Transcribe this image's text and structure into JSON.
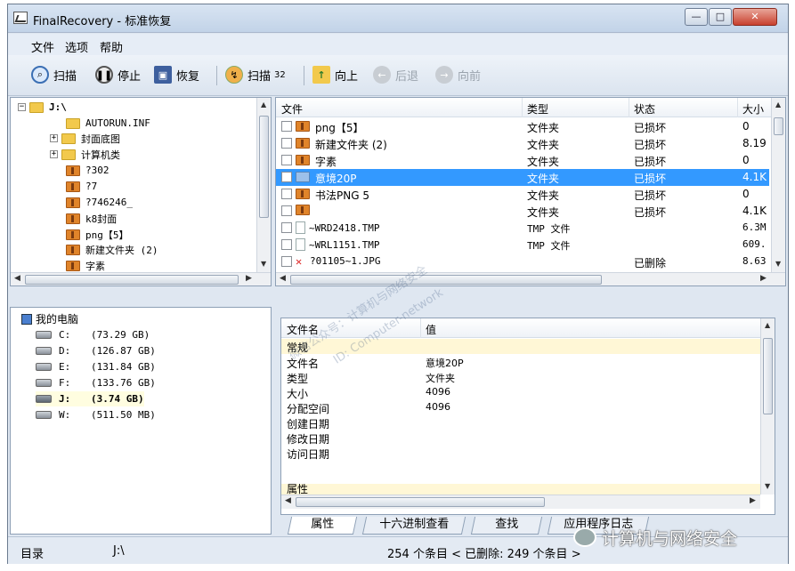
{
  "window": {
    "title": "FinalRecovery - 标准恢复",
    "min": "—",
    "max": "□",
    "close": "✕"
  },
  "menu": [
    "文件",
    "选项",
    "帮助"
  ],
  "toolbar": {
    "scan": "扫描",
    "stop": "停止",
    "recover": "恢复",
    "scan32": "扫描",
    "scan32_count": "32",
    "up": "向上",
    "back": "后退",
    "forward": "向前"
  },
  "tree": {
    "root": "J:\\",
    "items": [
      "AUTORUN.INF",
      "封面底图",
      "计算机类",
      "?302",
      "?7",
      "?746246_",
      "k8封面",
      "png【5】",
      "新建文件夹 (2)",
      "字素"
    ]
  },
  "drives": {
    "root": "我的电脑",
    "items": [
      {
        "letter": "C:",
        "size": "(73.29 GB)"
      },
      {
        "letter": "D:",
        "size": "(126.87 GB)"
      },
      {
        "letter": "E:",
        "size": "(131.84 GB)"
      },
      {
        "letter": "F:",
        "size": "(133.76 GB)"
      },
      {
        "letter": "J:",
        "size": "(3.74 GB)"
      },
      {
        "letter": "W:",
        "size": "(511.50 MB)"
      }
    ]
  },
  "files": {
    "columns": [
      "文件",
      "类型",
      "状态",
      "大小"
    ],
    "rows": [
      {
        "name": "png【5】",
        "type": "文件夹",
        "status": "已损坏",
        "size": "0"
      },
      {
        "name": "新建文件夹 (2)",
        "type": "文件夹",
        "status": "已损坏",
        "size": "8.19"
      },
      {
        "name": "字素",
        "type": "文件夹",
        "status": "已损坏",
        "size": "0"
      },
      {
        "name": "意境20P",
        "type": "文件夹",
        "status": "已损坏",
        "size": "4.1K"
      },
      {
        "name": "书法PNG 5",
        "type": "文件夹",
        "status": "已损坏",
        "size": "0"
      },
      {
        "name": "",
        "type": "文件夹",
        "status": "已损坏",
        "size": "4.1K"
      },
      {
        "name": "~WRD2418.TMP",
        "type": "TMP 文件",
        "status": "",
        "size": "6.3M"
      },
      {
        "name": "~WRL1151.TMP",
        "type": "TMP 文件",
        "status": "",
        "size": "609."
      },
      {
        "name": "?01105~1.JPG",
        "type": "",
        "status": "已删除",
        "size": "8.63"
      }
    ]
  },
  "properties": {
    "columns": [
      "文件名",
      "值"
    ],
    "group1": "常规",
    "rows": [
      {
        "key": "文件名",
        "value": "意境20P"
      },
      {
        "key": "类型",
        "value": "文件夹"
      },
      {
        "key": "大小",
        "value": "4096"
      },
      {
        "key": "分配空间",
        "value": "4096"
      },
      {
        "key": "创建日期",
        "value": ""
      },
      {
        "key": "修改日期",
        "value": ""
      },
      {
        "key": "访问日期",
        "value": ""
      }
    ],
    "group2": "属性"
  },
  "tabs": [
    "属性",
    "十六进制查看",
    "查找",
    "应用程序日志"
  ],
  "status": {
    "label": "目录",
    "path": "J:\\",
    "summary": "254 个条目 < 已删除: 249 个条目 >"
  },
  "watermark": {
    "line1": "微信公众号：计算机与网络安全",
    "line2": "ID: Computer-network"
  },
  "brand": "计算机与网络安全"
}
